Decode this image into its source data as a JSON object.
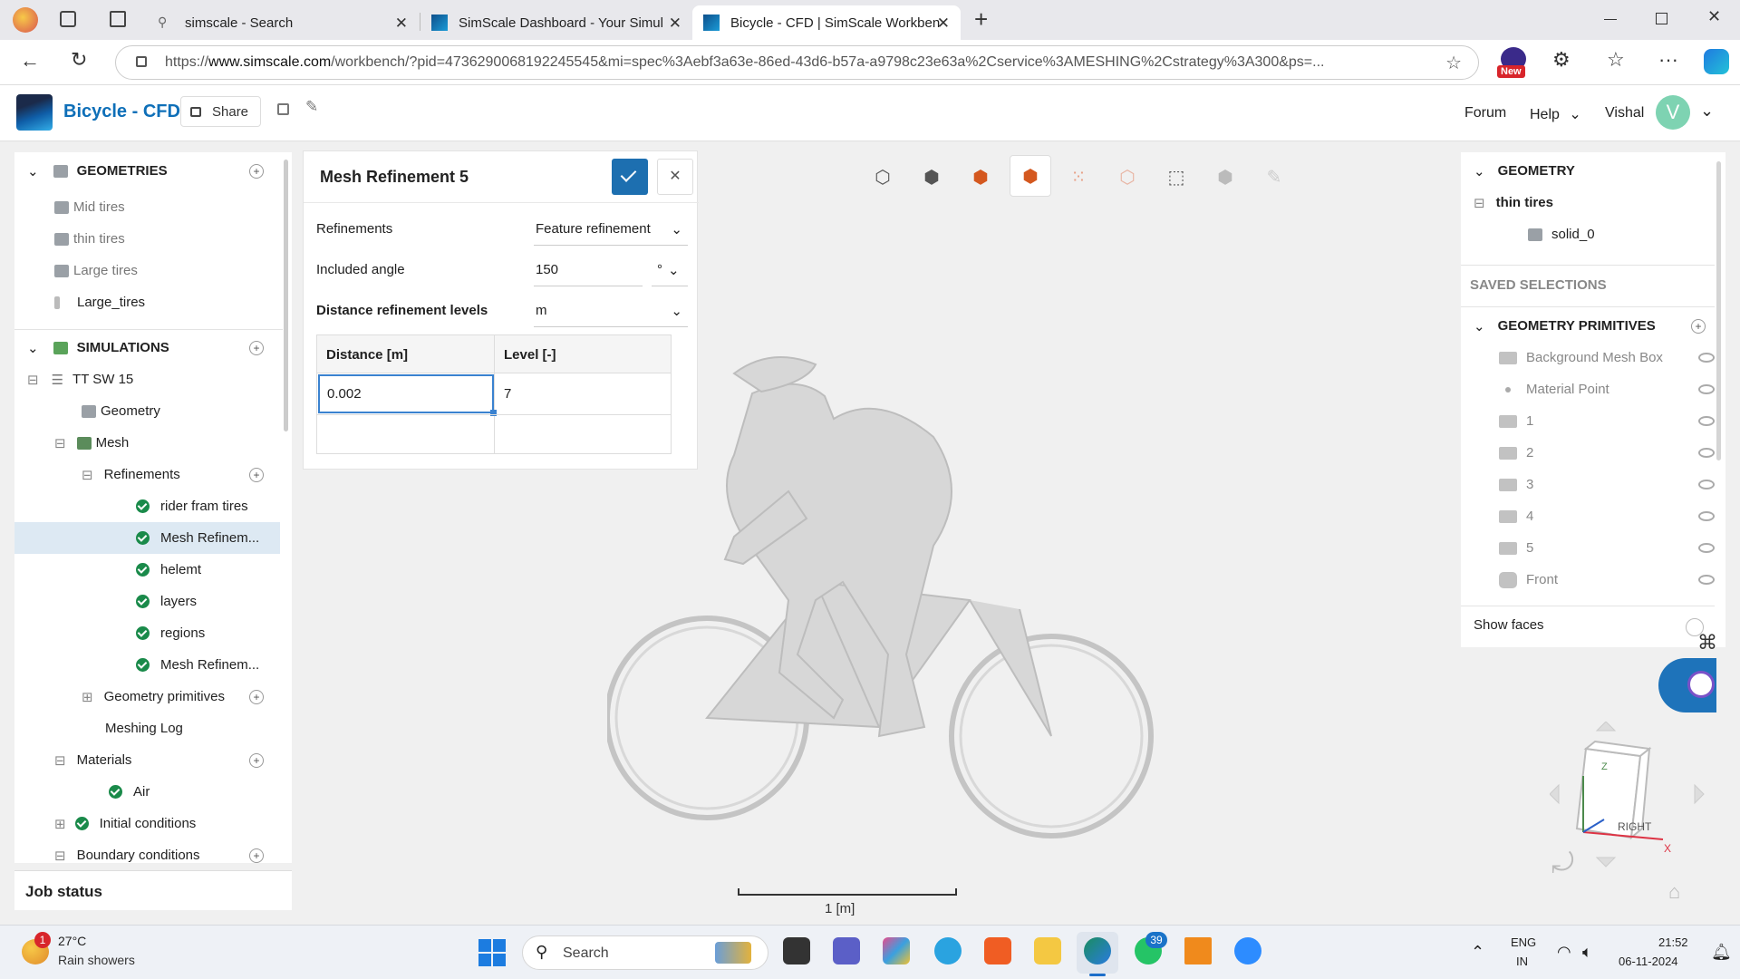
{
  "browser": {
    "tabs": [
      {
        "label": "simscale - Search"
      },
      {
        "label": "SimScale Dashboard - Your Simul"
      },
      {
        "label": "Bicycle - CFD | SimScale Workben"
      }
    ],
    "url_prefix": "https://",
    "url_domain": "www.simscale.com",
    "url_rest": "/workbench/?pid=4736290068192245545&mi=spec%3Aebf3a63e-86ed-43d6-b57a-a9798c23e63a%2Cservice%3AMESHING%2Cstrategy%3A300&ps=...",
    "new_badge": "New"
  },
  "app": {
    "title": "Bicycle - CFD",
    "share_label": "Share",
    "forum_label": "Forum",
    "help_label": "Help",
    "user_name": "Vishal",
    "user_initial": "V"
  },
  "left_tree": {
    "geometries_header": "GEOMETRIES",
    "geometries": [
      "Mid tires",
      "thin tires",
      "Large tires",
      "Large_tires"
    ],
    "simulations_header": "SIMULATIONS",
    "sim_name": "TT SW 15",
    "geometry": "Geometry",
    "mesh": "Mesh",
    "refinements": "Refinements",
    "refinement_items": [
      "rider fram tires",
      "Mesh Refinem...",
      "helemt",
      "layers",
      "regions",
      "Mesh Refinem..."
    ],
    "geometry_primitives": "Geometry primitives",
    "meshing_log": "Meshing Log",
    "materials": "Materials",
    "air": "Air",
    "initial_conditions": "Initial conditions",
    "boundary_conditions": "Boundary conditions"
  },
  "job_status": "Job status",
  "dialog": {
    "title": "Mesh Refinement 5",
    "refinements_label": "Refinements",
    "refinements_value": "Feature refinement",
    "included_angle_label": "Included angle",
    "included_angle_value": "150",
    "angle_unit": "°",
    "distance_levels_label": "Distance refinement levels",
    "distance_unit": "m",
    "col_distance": "Distance [m]",
    "col_level": "Level [-]",
    "row_distance": "0.002",
    "row_level": "7"
  },
  "viewport": {
    "scale_label": "1 [m]",
    "cube_label": "RIGHT",
    "axis_x": "X",
    "axis_z": "Z"
  },
  "right_panel": {
    "geometry_header": "GEOMETRY",
    "geometry_name": "thin tires",
    "solid": "solid_0",
    "saved_selections": "SAVED SELECTIONS",
    "primitives_header": "GEOMETRY PRIMITIVES",
    "primitives": [
      "Background Mesh Box",
      "Material Point",
      "1",
      "2",
      "3",
      "4",
      "5",
      "Front"
    ],
    "show_faces": "Show faces"
  },
  "taskbar": {
    "weather_temp": "27°C",
    "weather_desc": "Rain showers",
    "weather_badge": "1",
    "search_label": "Search",
    "whatsapp_badge": "39",
    "lang": "ENG",
    "region": "IN",
    "time": "21:52",
    "date": "06-11-2024"
  }
}
